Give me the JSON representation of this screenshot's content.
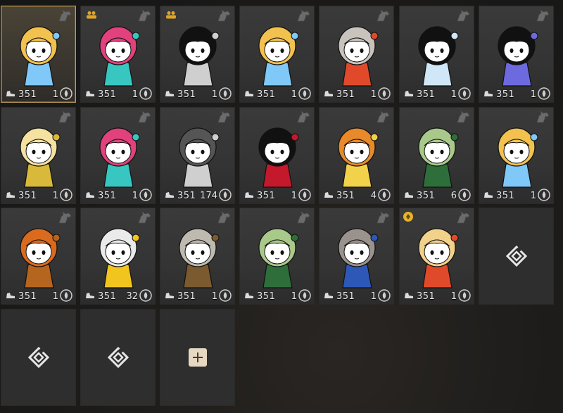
{
  "cards": [
    {
      "level": "351",
      "count": "1",
      "selected": true,
      "party": false,
      "color": "#f2c14e",
      "accent": "#7fc8f8"
    },
    {
      "level": "351",
      "count": "1",
      "selected": false,
      "party": true,
      "color": "#e1417c",
      "accent": "#38c6c0"
    },
    {
      "level": "351",
      "count": "1",
      "selected": false,
      "party": true,
      "color": "#111111",
      "accent": "#cfcfcf"
    },
    {
      "level": "351",
      "count": "1",
      "selected": false,
      "party": false,
      "color": "#f2c14e",
      "accent": "#7fc8f8"
    },
    {
      "level": "351",
      "count": "1",
      "selected": false,
      "party": false,
      "color": "#c8c3bd",
      "accent": "#e04a2a"
    },
    {
      "level": "351",
      "count": "1",
      "selected": false,
      "party": false,
      "color": "#111111",
      "accent": "#cfe7f7"
    },
    {
      "level": "351",
      "count": "1",
      "selected": false,
      "party": false,
      "color": "#111111",
      "accent": "#6d6ae0"
    },
    {
      "level": "351",
      "count": "1",
      "selected": false,
      "party": false,
      "color": "#f5e1a0",
      "accent": "#d9b93a"
    },
    {
      "level": "351",
      "count": "1",
      "selected": false,
      "party": false,
      "color": "#e1417c",
      "accent": "#38c6c0"
    },
    {
      "level": "351",
      "count": "174",
      "selected": false,
      "party": false,
      "color": "#555555",
      "accent": "#cfcfcf"
    },
    {
      "level": "351",
      "count": "1",
      "selected": false,
      "party": false,
      "color": "#111111",
      "accent": "#c4182c"
    },
    {
      "level": "351",
      "count": "4",
      "selected": false,
      "party": false,
      "color": "#e8892a",
      "accent": "#f2d24a"
    },
    {
      "level": "351",
      "count": "6",
      "selected": false,
      "party": false,
      "color": "#a9c98a",
      "accent": "#2e6e3a"
    },
    {
      "level": "351",
      "count": "1",
      "selected": false,
      "party": false,
      "color": "#f2c14e",
      "accent": "#7fc8f8"
    },
    {
      "level": "351",
      "count": "1",
      "selected": false,
      "party": false,
      "color": "#d96a1e",
      "accent": "#b5651d"
    },
    {
      "level": "351",
      "count": "32",
      "selected": false,
      "party": false,
      "color": "#eaeaea",
      "accent": "#f2c41e"
    },
    {
      "level": "351",
      "count": "1",
      "selected": false,
      "party": false,
      "color": "#bfbab0",
      "accent": "#7b5a30"
    },
    {
      "level": "351",
      "count": "1",
      "selected": false,
      "party": false,
      "color": "#a9c98a",
      "accent": "#2e6e3a"
    },
    {
      "level": "351",
      "count": "1",
      "selected": false,
      "party": false,
      "color": "#9a928c",
      "accent": "#2d58b8"
    },
    {
      "level": "351",
      "count": "1",
      "selected": false,
      "party": false,
      "color": "#f2d18a",
      "accent": "#e04a2a",
      "marker": true
    }
  ],
  "empty_slots": 3,
  "add_slot": true
}
